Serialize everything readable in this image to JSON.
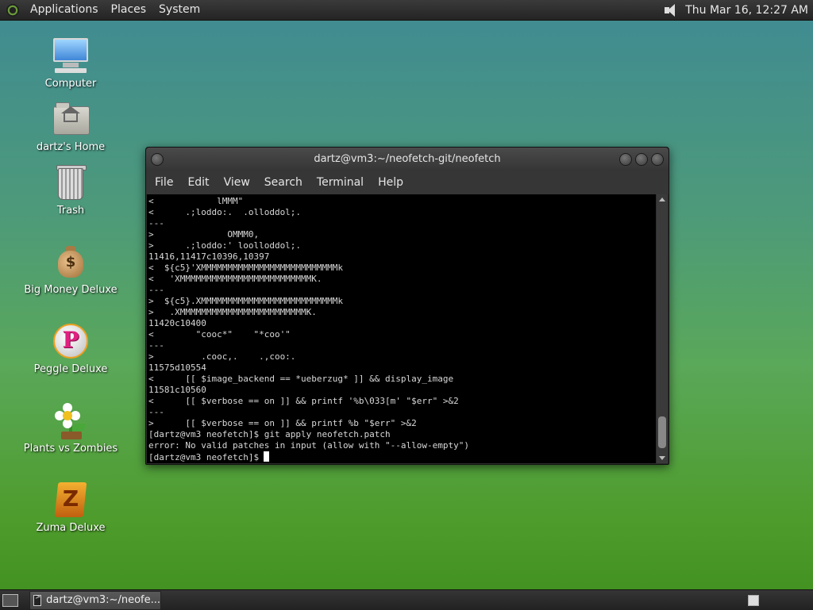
{
  "top_panel": {
    "menus": [
      "Applications",
      "Places",
      "System"
    ],
    "clock": "Thu Mar 16, 12:27 AM"
  },
  "desktop_icons": [
    {
      "label": "Computer",
      "icon": "computer-icon"
    },
    {
      "label": "dartz's Home",
      "icon": "home-folder-icon"
    },
    {
      "label": "Trash",
      "icon": "trash-icon"
    },
    {
      "label": "Big Money Deluxe",
      "icon": "money-bag-icon"
    },
    {
      "label": "Peggle Deluxe",
      "icon": "peggle-icon"
    },
    {
      "label": "Plants vs Zombies",
      "icon": "plants-vs-zombies-icon"
    },
    {
      "label": "Zuma Deluxe",
      "icon": "zuma-icon"
    }
  ],
  "terminal": {
    "title": "dartz@vm3:~/neofetch-git/neofetch",
    "menu": [
      "File",
      "Edit",
      "View",
      "Search",
      "Terminal",
      "Help"
    ],
    "lines": [
      "<            lMMM\"",
      "<      .;loddo:.  .olloddol;.",
      "---",
      ">              OMMM0,",
      ">      .;loddo:' loolloddol;.",
      "11416,11417c10396,10397",
      "<  ${c5}'XMMMMMMMMMMMMMMMMMMMMMMMMMMk",
      "<   'XMMMMMMMMMMMMMMMMMMMMMMMMMK.",
      "---",
      ">  ${c5}.XMMMMMMMMMMMMMMMMMMMMMMMMMMk",
      ">   .XMMMMMMMMMMMMMMMMMMMMMMMMK.",
      "11420c10400",
      "<        \"cooc*\"    \"*coo'\"",
      "---",
      ">         .cooc,.    .,coo:.",
      "11575d10554",
      "<      [[ $image_backend == *ueberzug* ]] && display_image",
      "11581c10560",
      "<      [[ $verbose == on ]] && printf '%b\\033[m' \"$err\" >&2",
      "---",
      ">      [[ $verbose == on ]] && printf %b \"$err\" >&2",
      "[dartz@vm3 neofetch]$ git apply neofetch.patch",
      "error: No valid patches in input (allow with \"--allow-empty\")",
      "[dartz@vm3 neofetch]$"
    ]
  },
  "bottom_panel": {
    "task_label": "dartz@vm3:~/neofe..."
  }
}
